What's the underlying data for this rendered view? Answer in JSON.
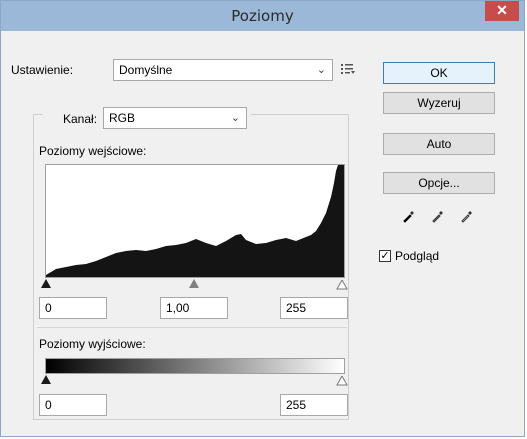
{
  "window": {
    "title": "Poziomy",
    "close_glyph": "✕"
  },
  "preset": {
    "label": "Ustawienie:",
    "value": "Domyślne",
    "menu_icon": "preset-menu-icon"
  },
  "channel": {
    "label": "Kanał:",
    "value": "RGB"
  },
  "input_levels": {
    "label": "Poziomy wejściowe:",
    "black": "0",
    "gamma": "1,00",
    "white": "255"
  },
  "output_levels": {
    "label": "Poziomy wyjściowe:",
    "black": "0",
    "white": "255"
  },
  "buttons": {
    "ok": "OK",
    "reset": "Wyzeruj",
    "auto": "Auto",
    "options": "Opcje..."
  },
  "preview": {
    "label": "Podgląd",
    "checked": true
  },
  "colors": {
    "titlebar": "#9bb8d9",
    "close": "#c94c4c",
    "panel": "#f0f0f0"
  }
}
